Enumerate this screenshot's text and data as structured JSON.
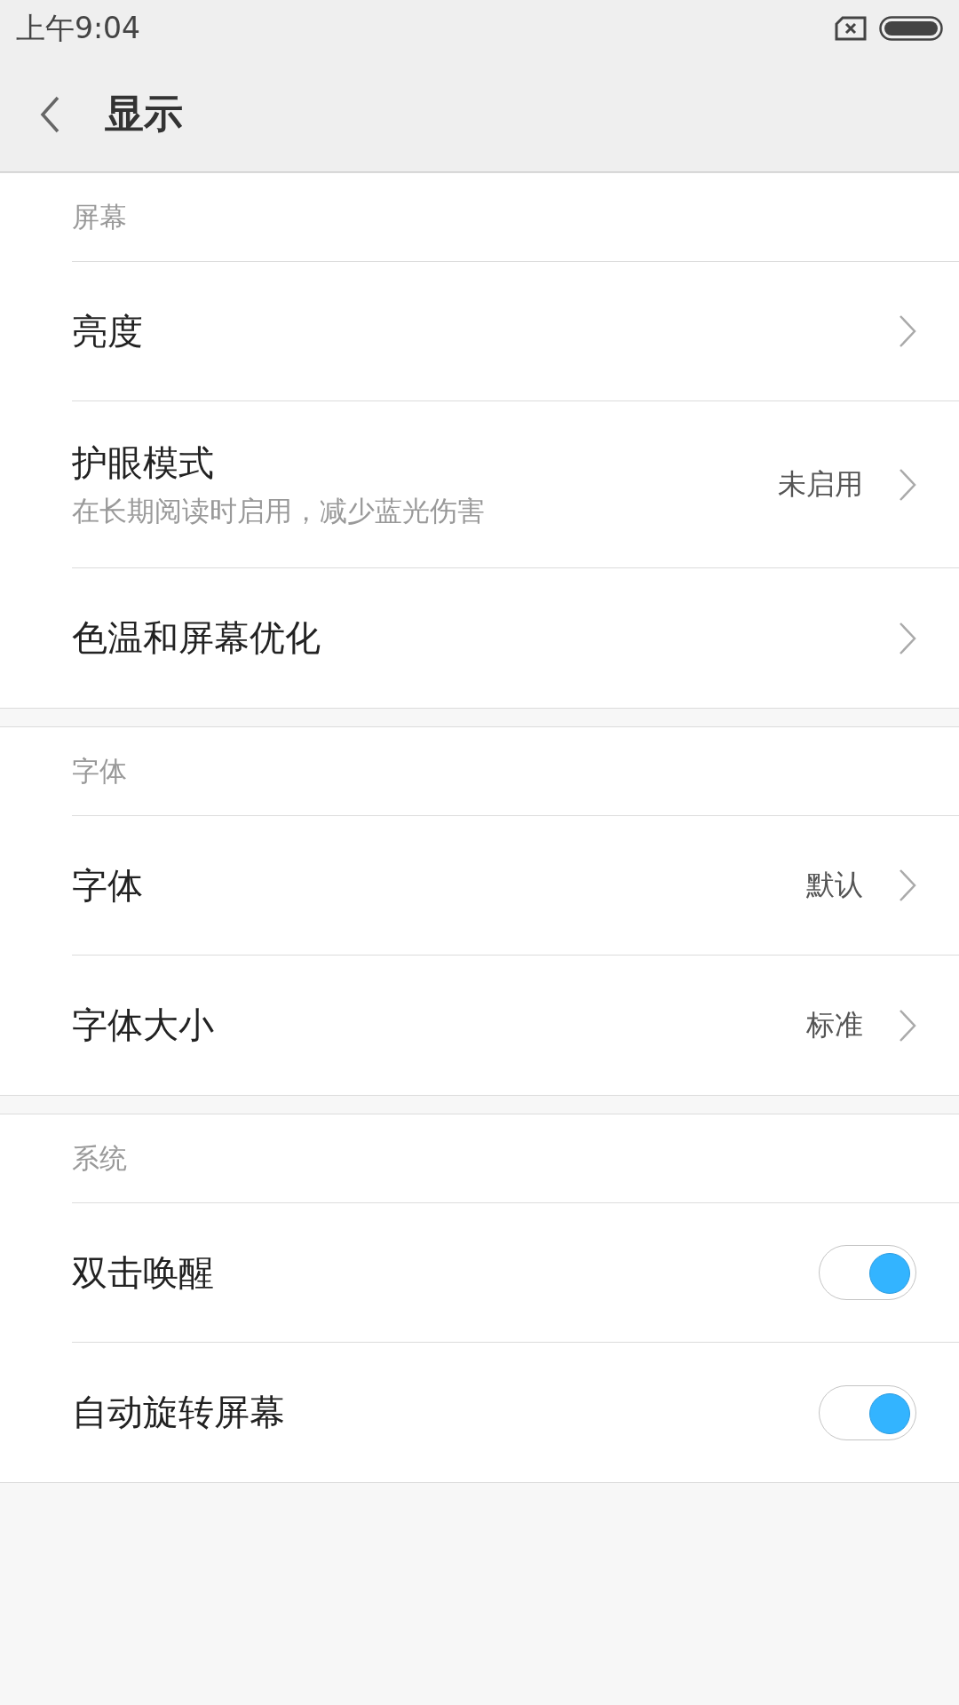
{
  "status_bar": {
    "time": "上午9:04"
  },
  "header": {
    "title": "显示"
  },
  "sections": [
    {
      "title": "屏幕",
      "items": [
        {
          "kind": "link",
          "label": "亮度"
        },
        {
          "kind": "link",
          "label": "护眼模式",
          "subtitle": "在长期阅读时启用，减少蓝光伤害",
          "value": "未启用"
        },
        {
          "kind": "link",
          "label": "色温和屏幕优化"
        }
      ]
    },
    {
      "title": "字体",
      "items": [
        {
          "kind": "link",
          "label": "字体",
          "value": "默认"
        },
        {
          "kind": "link",
          "label": "字体大小",
          "value": "标准"
        }
      ]
    },
    {
      "title": "系统",
      "items": [
        {
          "kind": "toggle",
          "label": "双击唤醒",
          "on": true
        },
        {
          "kind": "toggle",
          "label": "自动旋转屏幕",
          "on": true
        }
      ]
    }
  ]
}
